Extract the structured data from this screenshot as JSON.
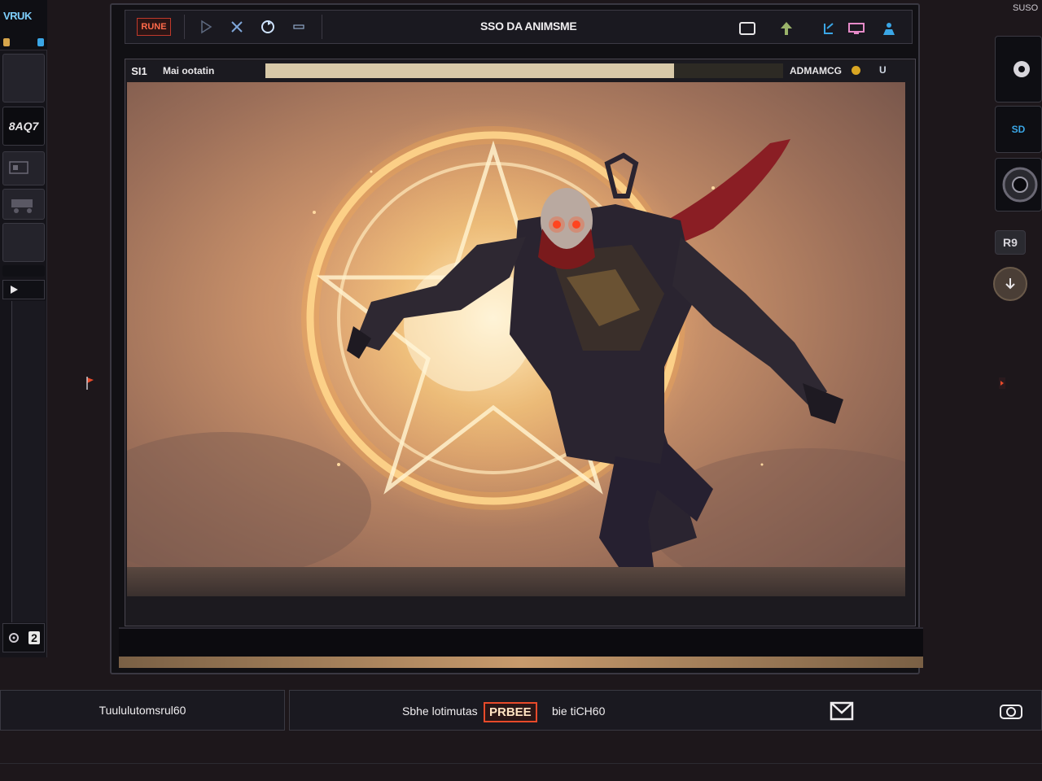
{
  "left_rail": {
    "brand": "VRUK",
    "label": "8AQ7",
    "bottom_badge": "2"
  },
  "toolbar": {
    "tool_label": "RUNE",
    "title": "SSO DA ANIMSME"
  },
  "viewer": {
    "id": "SI1",
    "label": "Mai ootatin",
    "right_label": "ADMAMCG",
    "end_label": "U",
    "progress": 0.79
  },
  "right_panel": {
    "label_a": "SD",
    "label_b": "R9"
  },
  "corner": "SUSO",
  "status": {
    "left": "Tuululutomsrul60",
    "mid_text": "Sbhe lotimutas",
    "badge": "PRBEE",
    "mid_text2": "bie tiCH60"
  },
  "colors": {
    "accent_red": "#e84a2a",
    "accent_blue": "#3aa6e6",
    "accent_gold": "#d9a623",
    "glow": "#ffd47a"
  }
}
